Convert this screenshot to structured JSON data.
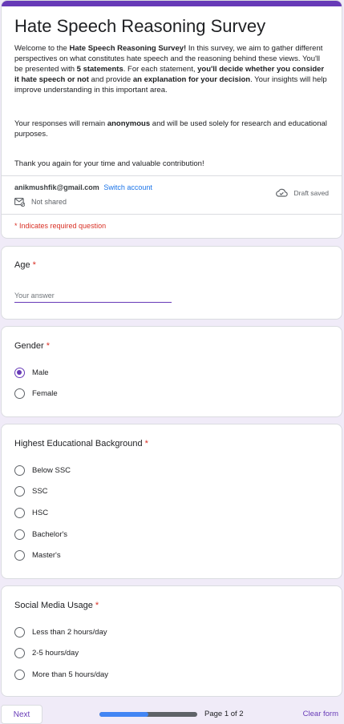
{
  "header": {
    "title": "Hate Speech Reasoning Survey",
    "intro": {
      "p1": "Welcome to the ",
      "b1": "Hate Speech Reasoning Survey!",
      "p2": " In this survey, we aim to gather different perspectives on what constitutes hate speech and the reasoning behind these views. You'll be presented with ",
      "b2": "5 statements",
      "p3": ". For each statement, ",
      "b3": "you'll decide whether you consider it hate speech or not",
      "p4": " and provide ",
      "b4": "an explanation for your decision",
      "p5": ". Your insights will help improve understanding in this important area."
    },
    "privacy": {
      "p1": "Your responses will remain ",
      "b1": "anonymous",
      "p2": " and will be used solely for research and educational purposes."
    },
    "thanks": "Thank you again for your time and valuable contribution!"
  },
  "account": {
    "email": "anikmushfik@gmail.com",
    "switch_label": "Switch account",
    "not_shared": "Not shared",
    "draft_status": "Draft saved"
  },
  "required_note": "* Indicates required question",
  "questions": {
    "age": {
      "title": "Age",
      "star": "*",
      "placeholder": "Your answer"
    },
    "gender": {
      "title": "Gender",
      "star": "*",
      "options": [
        "Male",
        "Female"
      ],
      "selected": "Male"
    },
    "education": {
      "title": "Highest Educational Background",
      "star": "*",
      "options": [
        "Below SSC",
        "SSC",
        "HSC",
        "Bachelor's",
        "Master's"
      ]
    },
    "social_media": {
      "title": "Social Media Usage",
      "star": "*",
      "options": [
        "Less than 2 hours/day",
        "2-5 hours/day",
        "More than 5 hours/day"
      ]
    }
  },
  "footer": {
    "next_label": "Next",
    "progress_fraction": 0.5,
    "page_text": "Page 1 of 2",
    "clear_label": "Clear form"
  },
  "colors": {
    "accent": "#673ab7",
    "background": "#f0ebf8",
    "required": "#d93025",
    "link": "#1a73e8",
    "progress": "#4285f4"
  }
}
